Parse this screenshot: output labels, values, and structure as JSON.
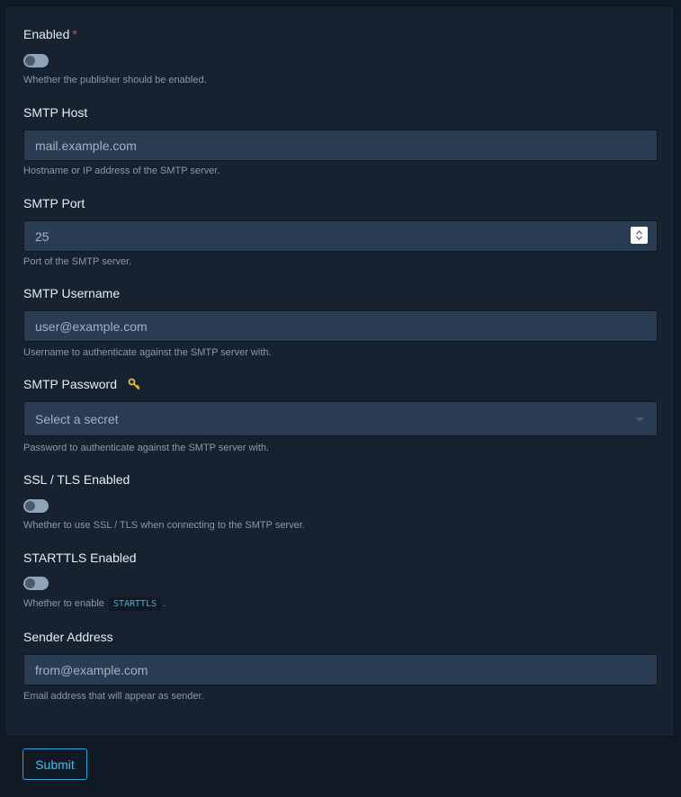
{
  "form": {
    "enabled": {
      "label": "Enabled",
      "required_mark": "*",
      "help": "Whether the publisher should be enabled.",
      "value": false
    },
    "smtp_host": {
      "label": "SMTP Host",
      "placeholder": "mail.example.com",
      "help": "Hostname or IP address of the SMTP server."
    },
    "smtp_port": {
      "label": "SMTP Port",
      "placeholder": "25",
      "help": "Port of the SMTP server."
    },
    "smtp_username": {
      "label": "SMTP Username",
      "placeholder": "user@example.com",
      "help": "Username to authenticate against the SMTP server with."
    },
    "smtp_password": {
      "label": "SMTP Password",
      "icon": "key-icon",
      "select_placeholder": "Select a secret",
      "help": "Password to authenticate against the SMTP server with."
    },
    "ssl_tls": {
      "label": "SSL / TLS Enabled",
      "help": "Whether to use SSL / TLS when connecting to the SMTP server.",
      "value": false
    },
    "starttls": {
      "label": "STARTTLS Enabled",
      "help_prefix": "Whether to enable",
      "help_code": "STARTTLS",
      "help_suffix": ".",
      "value": false
    },
    "sender_address": {
      "label": "Sender Address",
      "placeholder": "from@example.com",
      "help": "Email address that will appear as sender."
    }
  },
  "footer": {
    "submit_label": "Submit"
  },
  "colors": {
    "accent": "#2ea7d7",
    "required": "#e5484d",
    "key_icon": "#f0c419"
  }
}
